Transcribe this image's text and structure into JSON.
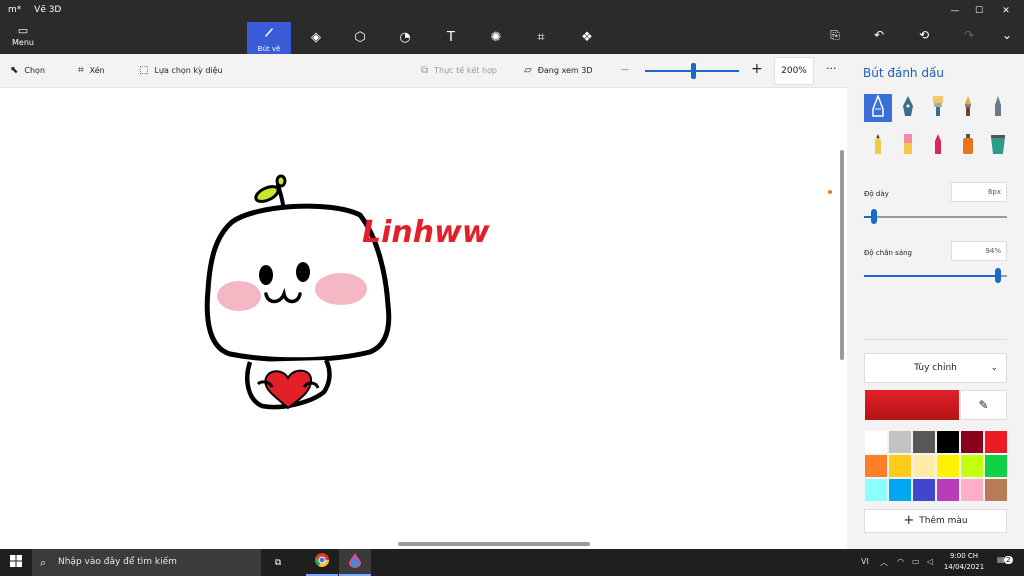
{
  "titlebar": {
    "doc_title": "m*",
    "app_title": "Vẽ 3D",
    "minimize": "—",
    "maximize": "☐",
    "close": "✕"
  },
  "ribbon": {
    "menu_label": "Menu",
    "active_tool_label": "Bút vẽ",
    "tools": [
      "brushes",
      "2d-shapes",
      "3d-shapes",
      "stickers",
      "text",
      "effects",
      "canvas",
      "3d-library"
    ]
  },
  "commandbar": {
    "select_label": "Chọn",
    "crop_label": "Xén",
    "magic_select_label": "Lựa chọn kỳ diệu",
    "mixed_reality_label": "Thực tế kết hợp",
    "view3d_label": "Đang xem 3D",
    "zoom_minus": "—",
    "zoom_plus": "+",
    "zoom_value": "200%",
    "zoom_level": 0.5,
    "more": "···"
  },
  "canvas": {
    "drawing_text": "Linhww",
    "accent_color": "#e3202a"
  },
  "panel": {
    "title": "Bút đánh dấu",
    "brushes": [
      "marker",
      "calligraphy-pen",
      "oil-brush",
      "watercolor",
      "pixel-pen",
      "pencil",
      "eraser",
      "crayon",
      "spray-can",
      "fill"
    ],
    "thickness_label": "Độ dày",
    "thickness_value": "6px",
    "thickness_level": 0.07,
    "opacity_label": "Độ chắn sáng",
    "opacity_value": "94%",
    "opacity_level": 0.94,
    "custom_label": "Tùy chỉnh",
    "selected_color": "#e3202a",
    "swatches": [
      "#ffffff",
      "#c3c3c3",
      "#585858",
      "#000000",
      "#88001b",
      "#ec1c24",
      "#ff7f27",
      "#ffca18",
      "#fdeca6",
      "#fff200",
      "#c4ff0e",
      "#0ed145",
      "#8cfffb",
      "#00a8f3",
      "#3f48cc",
      "#b83dba",
      "#ffaec8",
      "#b97a56"
    ],
    "add_color_label": "Thêm màu"
  },
  "taskbar": {
    "search_placeholder": "Nhập vào đây để tìm kiếm",
    "language": "VI",
    "time": "9:00 CH",
    "date": "14/04/2021",
    "notification_count": "2"
  }
}
